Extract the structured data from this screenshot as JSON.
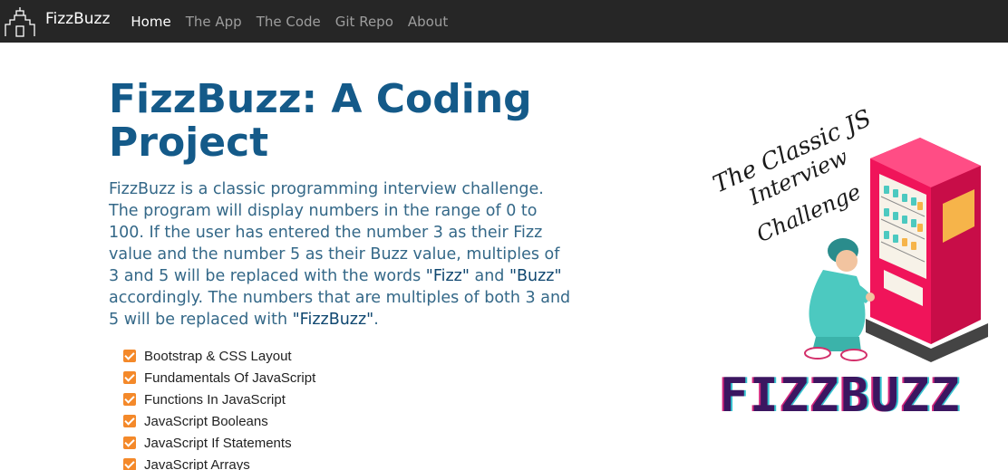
{
  "nav": {
    "brand": "FizzBuzz",
    "links": [
      {
        "label": "Home",
        "active": true
      },
      {
        "label": "The App",
        "active": false
      },
      {
        "label": "The Code",
        "active": false
      },
      {
        "label": "Git Repo",
        "active": false
      },
      {
        "label": "About",
        "active": false
      }
    ]
  },
  "hero": {
    "headline": "FizzBuzz: A Coding Project",
    "lead_start": "FizzBuzz is a classic programming interview challenge. The program will display numbers in the range of 0 to 100. If the user has entered the number 3 as their Fizz value and the number 5 as their Buzz value, multiples of 3 and 5 will be replaced with the words ",
    "fizz_quote": "\"Fizz\"",
    "and_text": " and ",
    "buzz_quote": "\"Buzz\"",
    "lead_mid": " accordingly. The numbers that are multiples of both 3 and 5 will be replaced with ",
    "fizzbuzz_quote": "\"FizzBuzz\"",
    "lead_end": "."
  },
  "features": [
    "Bootstrap & CSS Layout",
    "Fundamentals Of JavaScript",
    "Functions In JavaScript",
    "JavaScript Booleans",
    "JavaScript If Statements",
    "JavaScript Arrays"
  ],
  "illustration": {
    "script_lines": [
      "The Classic JS",
      "Interview",
      "Challenge"
    ],
    "logo_text": "FIZZBUZZ"
  },
  "colors": {
    "navbar": "#262626",
    "heading": "#145a89",
    "checkbox": "#f4892a",
    "machine": "#f0145a",
    "person": "#4cc9c0"
  }
}
